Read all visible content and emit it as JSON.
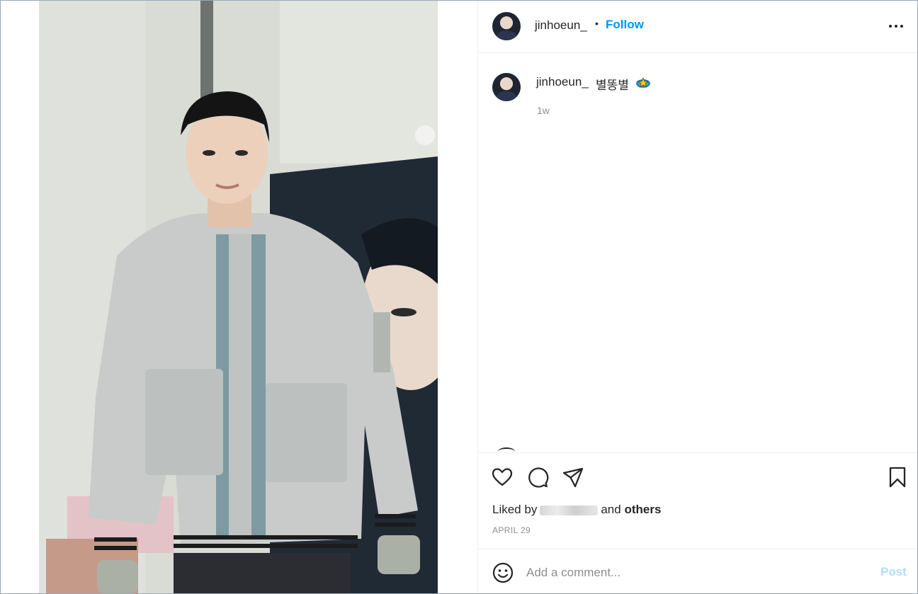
{
  "post": {
    "username": "jinhoeun_",
    "separator": "•",
    "follow_label": "Follow",
    "more_icon": "more-horizontal-icon",
    "caption_text": "별똥별",
    "caption_emoji": "shooting-star-emoji",
    "time_ago": "1w",
    "image_icon": "photo"
  },
  "actions": {
    "like_icon": "heart-icon",
    "comment_icon": "comment-icon",
    "share_icon": "send-icon",
    "save_icon": "bookmark-icon"
  },
  "likes": {
    "prefix": "Liked by",
    "connector": "and",
    "others_label": "others"
  },
  "date": "APRIL 29",
  "comment": {
    "emoji_icon": "smile-icon",
    "placeholder": "Add a comment...",
    "post_label": "Post"
  },
  "colors": {
    "accent": "#0095f6",
    "post_disabled": "#b3dffc",
    "muted": "#8e8e8e"
  }
}
